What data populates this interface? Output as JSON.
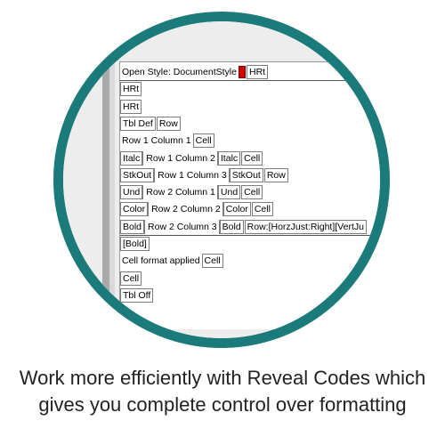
{
  "reveal_codes": {
    "lines": [
      {
        "items": [
          {
            "t": "plain",
            "label": "Open Style: DocumentStyle"
          },
          {
            "t": "red"
          },
          {
            "t": "code",
            "label": "HRt"
          }
        ]
      },
      {
        "items": [
          {
            "t": "code",
            "label": "HRt"
          }
        ]
      },
      {
        "items": [
          {
            "t": "code",
            "label": "HRt"
          }
        ]
      },
      {
        "items": [
          {
            "t": "code",
            "label": "Tbl Def"
          },
          {
            "t": "code",
            "label": "Row"
          }
        ]
      },
      {
        "items": [
          {
            "t": "plain",
            "label": "Row 1 Column 1"
          },
          {
            "t": "code",
            "label": "Cell"
          }
        ]
      },
      {
        "items": [
          {
            "t": "code-r",
            "label": "Italc"
          },
          {
            "t": "plain",
            "label": "Row 1 Column 2"
          },
          {
            "t": "code-l",
            "label": "Italc"
          },
          {
            "t": "code",
            "label": "Cell"
          }
        ]
      },
      {
        "items": [
          {
            "t": "code-r",
            "label": "StkOut"
          },
          {
            "t": "plain",
            "label": "Row 1 Column 3"
          },
          {
            "t": "code-l",
            "label": "StkOut"
          },
          {
            "t": "code",
            "label": "Row"
          }
        ]
      },
      {
        "items": [
          {
            "t": "code-r",
            "label": "Und"
          },
          {
            "t": "plain",
            "label": "Row 2 Column 1"
          },
          {
            "t": "code-l",
            "label": "Und"
          },
          {
            "t": "code",
            "label": "Cell"
          }
        ]
      },
      {
        "items": [
          {
            "t": "code-r",
            "label": "Color"
          },
          {
            "t": "plain",
            "label": "Row 2 Column 2"
          },
          {
            "t": "code-l",
            "label": "Color"
          },
          {
            "t": "code",
            "label": "Cell"
          }
        ]
      },
      {
        "items": [
          {
            "t": "code-r",
            "label": "Bold"
          },
          {
            "t": "plain",
            "label": "Row 2 Column 3"
          },
          {
            "t": "code-l",
            "label": "Bold"
          },
          {
            "t": "code",
            "label": "Row:[HorzJust:Right][VertJu"
          }
        ]
      },
      {
        "items": [
          {
            "t": "code",
            "label": "[Bold]"
          }
        ]
      },
      {
        "items": [
          {
            "t": "plain",
            "label": "Cell format applied"
          },
          {
            "t": "code",
            "label": "Cell"
          }
        ]
      },
      {
        "items": [
          {
            "t": "code",
            "label": "Cell"
          }
        ]
      },
      {
        "items": [
          {
            "t": "code",
            "label": "Tbl Off"
          }
        ]
      }
    ]
  },
  "caption": {
    "line1": "Work more efficiently with Reveal Codes which",
    "line2": "gives you complete control over formatting"
  },
  "colors": {
    "ring": "#1b7a7a",
    "color_swatch": "#d40000"
  }
}
